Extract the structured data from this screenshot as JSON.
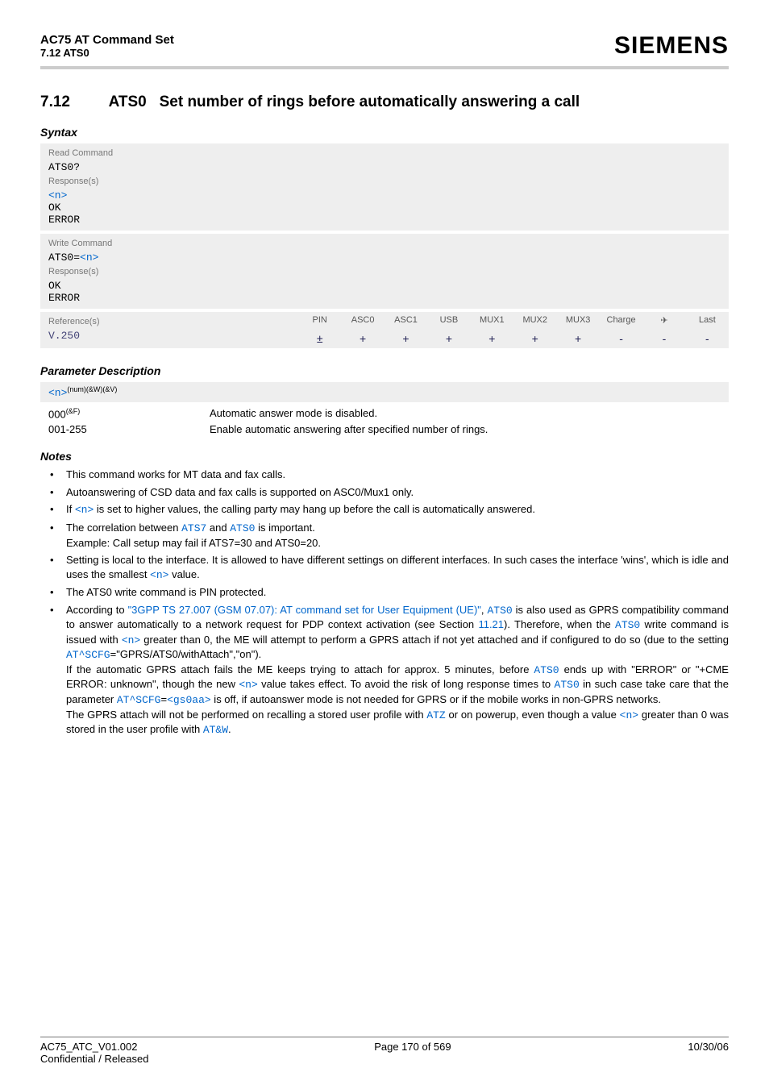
{
  "header": {
    "title": "AC75 AT Command Set",
    "subtitle": "7.12 ATS0",
    "brand": "SIEMENS"
  },
  "section": {
    "number": "7.12",
    "cmd": "ATS0",
    "title": "Set number of rings before automatically answering a call"
  },
  "syntax": {
    "heading": "Syntax",
    "read": {
      "label": "Read Command",
      "cmd": "ATS0?",
      "resp_label": "Response(s)",
      "resp_n": "<n>",
      "resp_ok": "OK",
      "resp_err": "ERROR"
    },
    "write": {
      "label": "Write Command",
      "cmd_prefix": "ATS0=",
      "cmd_n": "<n>",
      "resp_label": "Response(s)",
      "resp_ok": "OK",
      "resp_err": "ERROR"
    },
    "refs": {
      "label": "Reference(s)",
      "value": "V.250",
      "cols": [
        "PIN",
        "ASC0",
        "ASC1",
        "USB",
        "MUX1",
        "MUX2",
        "MUX3",
        "Charge",
        "✈",
        "Last"
      ],
      "vals": [
        "±",
        "+",
        "+",
        "+",
        "+",
        "+",
        "+",
        "-",
        "-",
        "-"
      ]
    }
  },
  "params": {
    "heading": "Parameter Description",
    "n_label": "<n>",
    "n_sup": "(num)(&W)(&V)",
    "rows": [
      {
        "key": "000",
        "key_sup": "(&F)",
        "desc": "Automatic answer mode is disabled."
      },
      {
        "key": "001-255",
        "key_sup": "",
        "desc": "Enable automatic answering after specified number of rings."
      }
    ]
  },
  "notes": {
    "heading": "Notes",
    "items": [
      {
        "segments": [
          {
            "t": "This command works for MT data and fax calls."
          }
        ]
      },
      {
        "segments": [
          {
            "t": "Autoanswering of CSD data and fax calls is supported on ASC0/Mux1 only."
          }
        ]
      },
      {
        "segments": [
          {
            "t": "If "
          },
          {
            "t": "<n>",
            "link": true,
            "mono": true
          },
          {
            "t": " is set to higher values, the calling party may hang up before the call is automatically answered."
          }
        ]
      },
      {
        "segments": [
          {
            "t": "The correlation between "
          },
          {
            "t": "ATS7",
            "link": true,
            "mono": true
          },
          {
            "t": " and "
          },
          {
            "t": "ATS0",
            "link": true,
            "mono": true
          },
          {
            "t": " is important."
          },
          {
            "br": true
          },
          {
            "t": "Example: Call setup may fail if ATS7=30 and ATS0=20."
          }
        ]
      },
      {
        "segments": [
          {
            "t": "Setting is local to the interface. It is allowed to have different settings on different interfaces. In such cases the interface 'wins', which is idle and uses the smallest "
          },
          {
            "t": "<n>",
            "link": true,
            "mono": true
          },
          {
            "t": " value."
          }
        ]
      },
      {
        "segments": [
          {
            "t": "The ATS0 write command is PIN protected."
          }
        ]
      },
      {
        "segments": [
          {
            "t": "According to "
          },
          {
            "t": "\"3GPP TS 27.007 (GSM 07.07): AT command set for User Equipment (UE)\"",
            "link": true
          },
          {
            "t": ", "
          },
          {
            "t": "ATS0",
            "link": true,
            "mono": true
          },
          {
            "t": " is also used as GPRS compatibility command to answer automatically to a network request for PDP context activation (see Section "
          },
          {
            "t": "11.21",
            "link": true
          },
          {
            "t": "). Therefore, when the "
          },
          {
            "t": "ATS0",
            "link": true,
            "mono": true
          },
          {
            "t": " write command is issued with "
          },
          {
            "t": "<n>",
            "link": true,
            "mono": true
          },
          {
            "t": " greater than 0, the ME will attempt to perform a GPRS attach if not yet attached and if configured to do so (due to the setting "
          },
          {
            "t": "AT^SCFG",
            "link": true,
            "mono": true
          },
          {
            "t": "=\"GPRS/ATS0/withAttach\",\"on\")."
          },
          {
            "br": true
          },
          {
            "t": "If the automatic GPRS attach fails the ME keeps trying to attach for approx. 5 minutes, before "
          },
          {
            "t": "ATS0",
            "link": true,
            "mono": true
          },
          {
            "t": " ends up with \"ERROR\" or \"+CME ERROR: unknown\", though the new "
          },
          {
            "t": "<n>",
            "link": true,
            "mono": true
          },
          {
            "t": " value takes effect. To avoid the risk of long response times to "
          },
          {
            "t": "ATS0",
            "link": true,
            "mono": true
          },
          {
            "t": " in such case take care that the parameter "
          },
          {
            "t": "AT^SCFG",
            "link": true,
            "mono": true
          },
          {
            "t": "="
          },
          {
            "t": "<gs0aa>",
            "link": true,
            "mono": true
          },
          {
            "t": " is off, if autoanswer mode is not needed for GPRS or if the mobile works in non-GPRS networks."
          },
          {
            "br": true
          },
          {
            "t": "The GPRS attach will not be performed on recalling a stored user profile with "
          },
          {
            "t": "ATZ",
            "link": true,
            "mono": true
          },
          {
            "t": " or on powerup, even though a value "
          },
          {
            "t": "<n>",
            "link": true,
            "mono": true
          },
          {
            "t": " greater than 0 was stored in the user profile with "
          },
          {
            "t": "AT&W",
            "link": true,
            "mono": true
          },
          {
            "t": "."
          }
        ]
      }
    ]
  },
  "footer": {
    "left1": "AC75_ATC_V01.002",
    "left2": "Confidential / Released",
    "center": "Page 170 of 569",
    "right": "10/30/06"
  }
}
